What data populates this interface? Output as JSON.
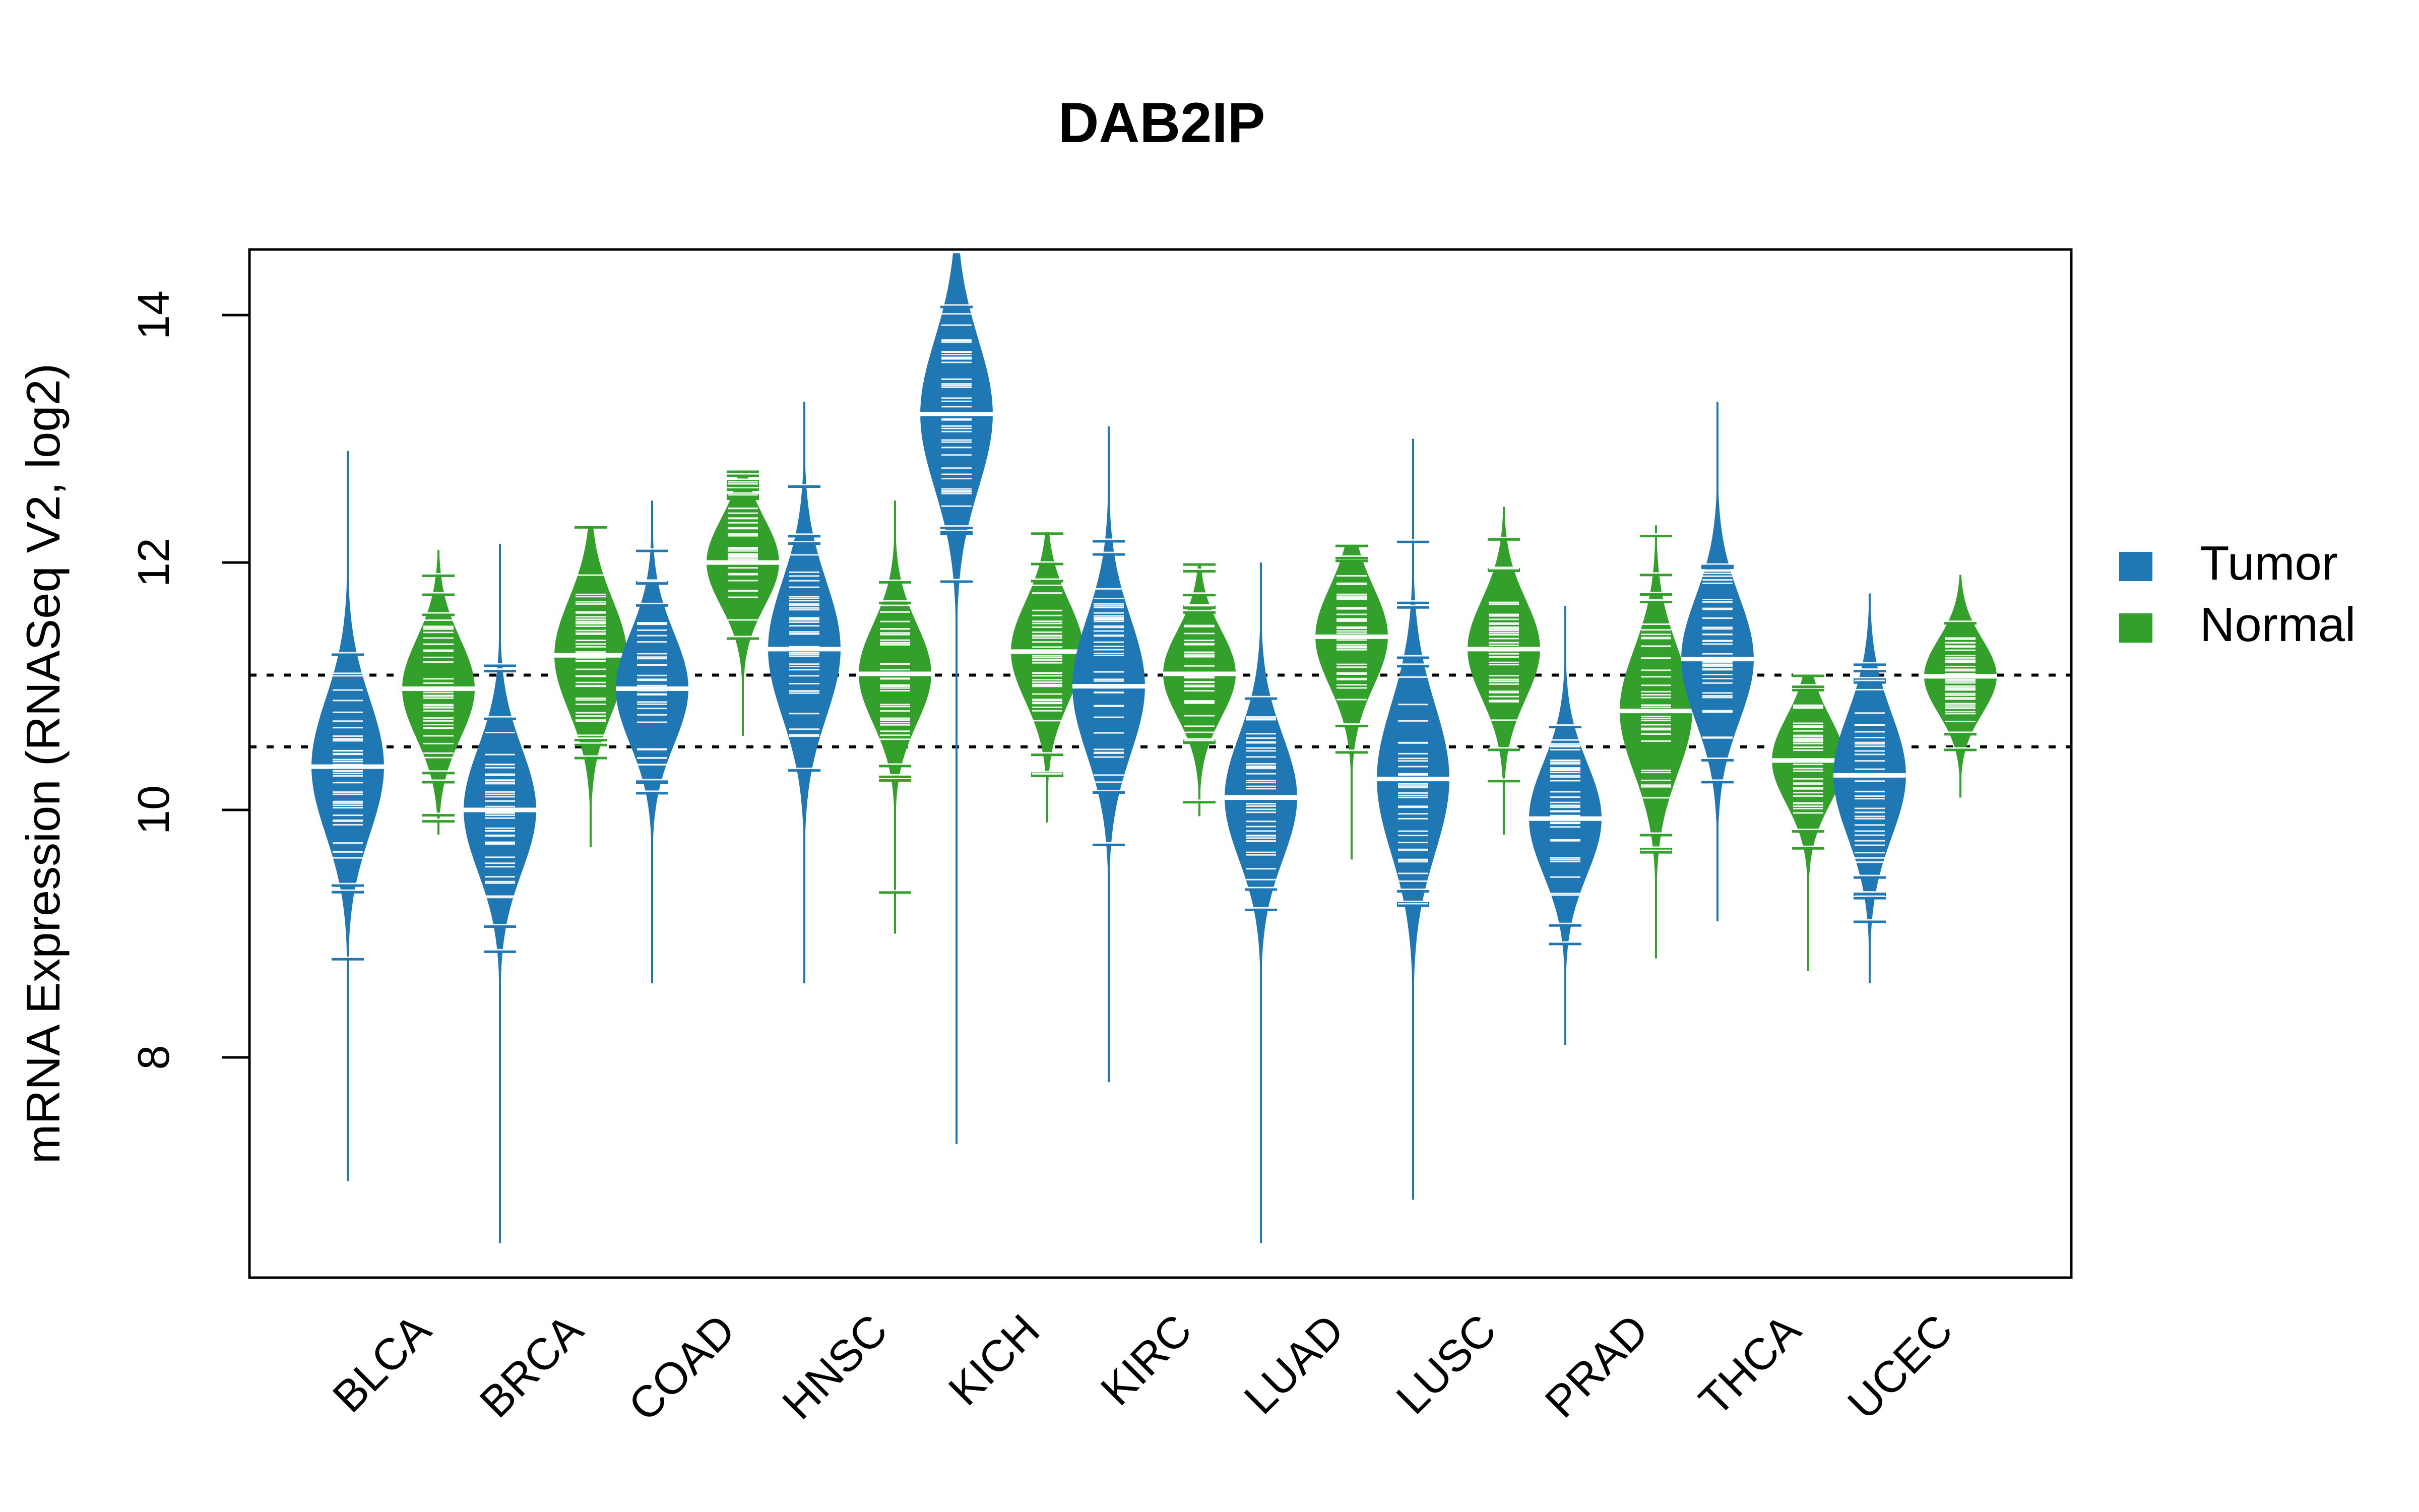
{
  "chart_data": {
    "type": "beanplot",
    "title": "DAB2IP",
    "xlabel": "",
    "ylabel": "mRNA Expression (RNASeq V2, log2)",
    "ylim": [
      6.22,
      14.53
    ],
    "yticks": [
      8,
      10,
      12,
      14
    ],
    "grid": false,
    "reference_lines": [
      11.09,
      10.51
    ],
    "legend": {
      "placement": "right",
      "entries": [
        {
          "name": "Tumor",
          "color": "#1F78B4"
        },
        {
          "name": "Normal",
          "color": "#33A02C"
        }
      ]
    },
    "categories": [
      "BLCA",
      "BRCA",
      "COAD",
      "HNSC",
      "KICH",
      "KIRC",
      "LUAD",
      "LUSC",
      "PRAD",
      "THCA",
      "UCEC"
    ],
    "series": [
      {
        "name": "Tumor",
        "color": "#1F78B4",
        "median": [
          10.35,
          10.0,
          10.98,
          11.3,
          13.2,
          11.0,
          10.1,
          10.25,
          9.93,
          11.22,
          10.28
        ],
        "min": [
          7.0,
          6.5,
          8.6,
          8.6,
          7.3,
          7.8,
          6.5,
          6.85,
          8.1,
          9.1,
          8.6
        ],
        "max": [
          12.9,
          12.15,
          12.5,
          13.3,
          14.5,
          13.1,
          12.0,
          13.0,
          11.65,
          13.3,
          11.75
        ],
        "spread": [
          0.55,
          0.5,
          0.45,
          0.55,
          0.6,
          0.55,
          0.5,
          0.6,
          0.45,
          0.5,
          0.5
        ]
      },
      {
        "name": "Normal",
        "color": "#33A02C",
        "median": [
          10.98,
          11.25,
          12.0,
          11.1,
          11.28,
          11.1,
          11.4,
          11.3,
          10.8,
          10.4,
          11.08
        ],
        "min": [
          9.8,
          9.7,
          10.6,
          9.0,
          9.9,
          9.95,
          9.6,
          9.8,
          8.8,
          8.7,
          10.1
        ],
        "max": [
          12.1,
          12.3,
          12.75,
          12.5,
          12.25,
          12.0,
          12.15,
          12.45,
          12.3,
          11.1,
          11.9
        ],
        "spread": [
          0.4,
          0.45,
          0.35,
          0.4,
          0.4,
          0.35,
          0.4,
          0.4,
          0.5,
          0.35,
          0.3
        ]
      }
    ]
  }
}
